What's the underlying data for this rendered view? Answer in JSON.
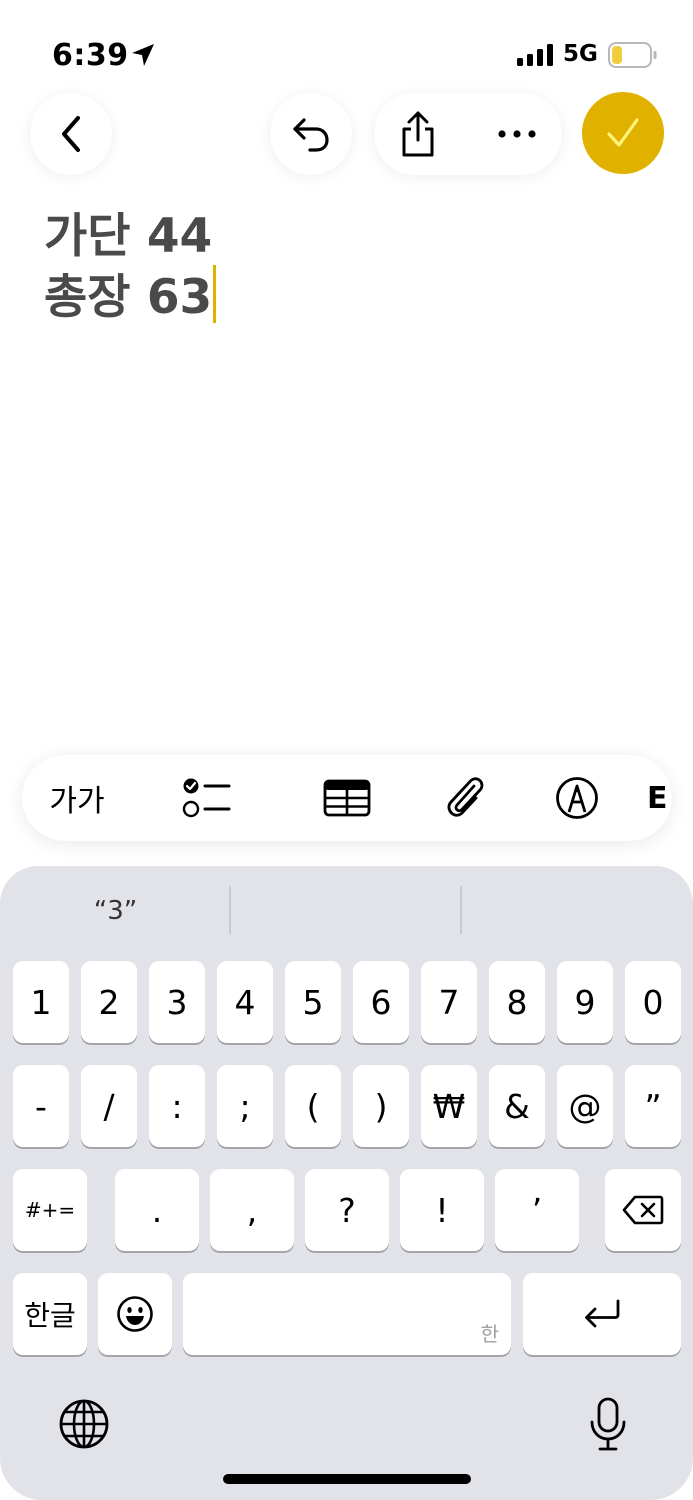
{
  "status_bar": {
    "time": "6:39",
    "network": "5G",
    "battery_color": "#f2cc3d"
  },
  "toolbar": {
    "back_icon": "chevron-left-icon",
    "undo_icon": "undo-icon",
    "share_icon": "share-icon",
    "more_icon": "ellipsis-icon",
    "done_icon": "checkmark-icon",
    "accent": "#e1b100"
  },
  "note": {
    "lines": [
      "가단 44",
      "총장 63"
    ]
  },
  "format_bar": {
    "text_style_label": "가가",
    "items": [
      "text-style",
      "checklist-icon",
      "table-icon",
      "paperclip-icon",
      "markup-pen-icon"
    ],
    "partial_label": "E"
  },
  "keyboard": {
    "suggestions": [
      "“3”",
      "",
      ""
    ],
    "row1": [
      "1",
      "2",
      "3",
      "4",
      "5",
      "6",
      "7",
      "8",
      "9",
      "0"
    ],
    "row2": [
      "-",
      "/",
      ":",
      ";",
      "(",
      ")",
      "₩",
      "&",
      "@",
      "”"
    ],
    "row3": {
      "shift_label": "#+=",
      "keys": [
        ".",
        ",",
        "?",
        "!",
        "’"
      ],
      "delete_icon": "backspace-icon"
    },
    "row4": {
      "lang_label": "한글",
      "emoji_icon": "emoji-icon",
      "space_hint": "한",
      "return_icon": "return-icon"
    },
    "bottom": {
      "globe_icon": "globe-icon",
      "mic_icon": "microphone-icon"
    }
  }
}
